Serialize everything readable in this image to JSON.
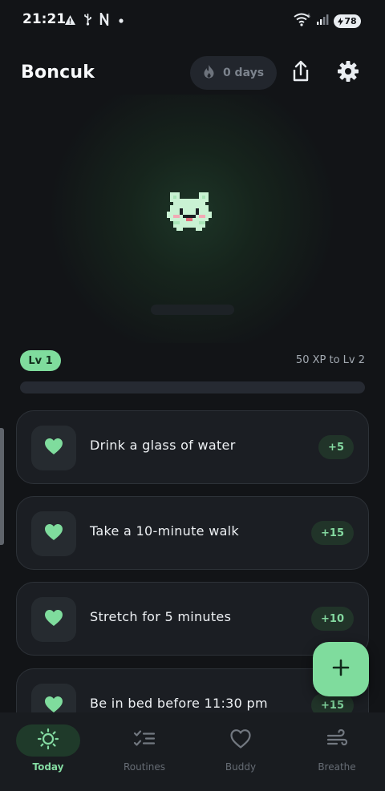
{
  "status_bar": {
    "time": "21:21",
    "battery": "78",
    "left_icons": [
      "warning-icon",
      "usb-icon",
      "n-icon",
      "dot-icon"
    ],
    "right_icons": [
      "wifi-icon",
      "signal-icon",
      "battery-icon"
    ]
  },
  "header": {
    "title": "Boncuk",
    "streak_label": "0 days",
    "streak_icon": "flame-icon",
    "share_icon": "share-icon",
    "settings_icon": "gear-icon"
  },
  "pet": {
    "icon": "pixel-pet-icon"
  },
  "level": {
    "badge": "Lv 1",
    "xp_to_next": "50 XP to Lv 2",
    "progress": 0.0
  },
  "tasks": [
    {
      "label": "Drink a glass of water",
      "xp": "+5",
      "icon": "heart-icon"
    },
    {
      "label": "Take a 10-minute walk",
      "xp": "+15",
      "icon": "heart-icon"
    },
    {
      "label": "Stretch for 5 minutes",
      "xp": "+10",
      "icon": "heart-icon"
    },
    {
      "label": "Be in bed before 11:30 pm",
      "xp": "+15",
      "icon": "heart-icon"
    }
  ],
  "fab": {
    "icon": "plus-icon"
  },
  "nav": {
    "active": "Today",
    "items": [
      {
        "label": "Today",
        "icon": "sun-icon"
      },
      {
        "label": "Routines",
        "icon": "checklist-icon"
      },
      {
        "label": "Buddy",
        "icon": "heart-outline-icon"
      },
      {
        "label": "Breathe",
        "icon": "wind-icon"
      }
    ]
  },
  "colors": {
    "accent": "#7fdc9d",
    "background": "#121417",
    "card": "#1b1e23",
    "chip": "#213429"
  }
}
